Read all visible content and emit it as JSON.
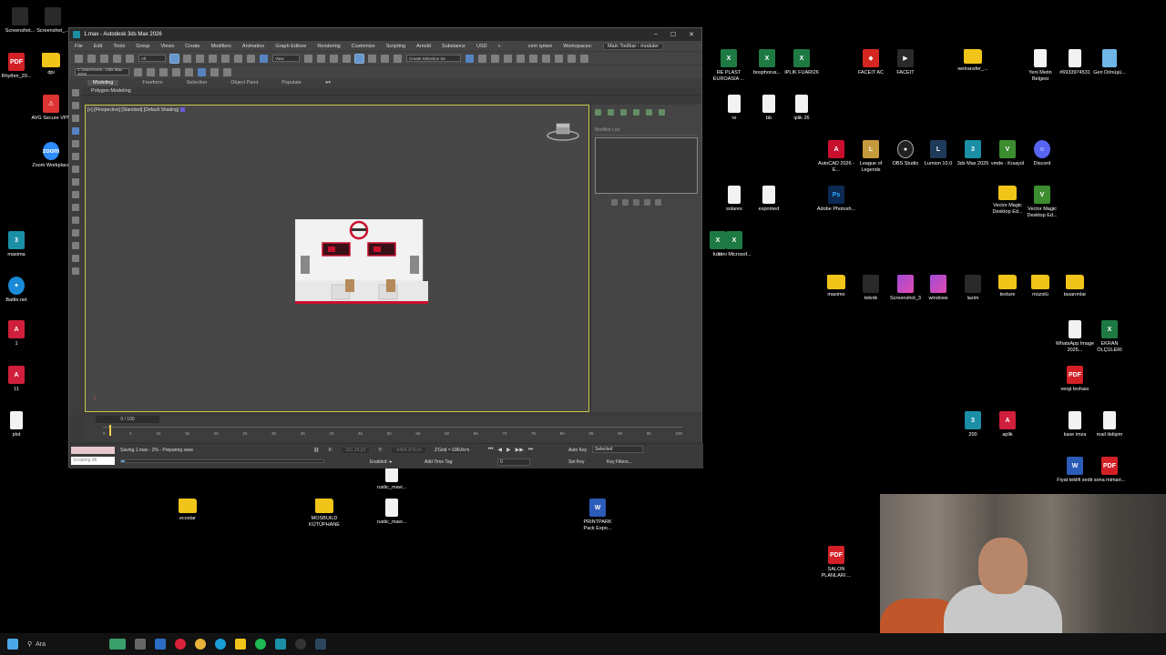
{
  "desktop": {
    "icons": [
      {
        "id": "screenshot1",
        "label": "Screenshot...",
        "type": "t-dark",
        "glyph": ""
      },
      {
        "id": "screenshot2",
        "label": "Screenshot_...",
        "type": "t-dark",
        "glyph": ""
      },
      {
        "id": "rhythm",
        "label": "Rhythm_20...",
        "type": "t-pdf",
        "glyph": "PDF"
      },
      {
        "id": "dpi",
        "label": "dpi",
        "type": "t-folder",
        "glyph": ""
      },
      {
        "id": "avg",
        "label": "AVG Secure VPN",
        "type": "t-avg",
        "glyph": "⚠"
      },
      {
        "id": "zoom",
        "label": "Zoom Workplace",
        "type": "t-zoom",
        "glyph": "zoom"
      },
      {
        "id": "maxima",
        "label": "maxima",
        "type": "t-max",
        "glyph": "3"
      },
      {
        "id": "battlenet",
        "label": "Battle.net",
        "type": "t-bnet",
        "glyph": "✦"
      },
      {
        "id": "fbx1",
        "label": "1",
        "type": "t-fbx",
        "glyph": "A"
      },
      {
        "id": "fbx11",
        "label": "11",
        "type": "t-fbx",
        "glyph": "A"
      },
      {
        "id": "plot",
        "label": "plot",
        "type": "t-file",
        "glyph": ""
      },
      {
        "id": "ecostar",
        "label": "ecostar",
        "type": "t-folder",
        "glyph": ""
      },
      {
        "id": "mosbuild",
        "label": "MOSBUILD KÜTÜPHANE",
        "type": "t-folder",
        "glyph": ""
      },
      {
        "id": "rustic2",
        "label": "rustic_mavi...",
        "type": "t-file",
        "glyph": ""
      },
      {
        "id": "rustic1",
        "label": "rustic_mavi...",
        "type": "t-file",
        "glyph": ""
      },
      {
        "id": "printpark",
        "label": "PRINTPARK Pack Expo...",
        "type": "t-doc",
        "glyph": "W"
      },
      {
        "id": "rexls",
        "label": "RE PLAST EUROASIA ...",
        "type": "t-xls",
        "glyph": "X"
      },
      {
        "id": "bosphorus",
        "label": "bosphorus...",
        "type": "t-xls",
        "glyph": "X"
      },
      {
        "id": "iplik",
        "label": "IPLIK FUARI26",
        "type": "t-xls",
        "glyph": "X"
      },
      {
        "id": "re",
        "label": "re",
        "type": "t-file",
        "glyph": ""
      },
      {
        "id": "bb",
        "label": "bb",
        "type": "t-file",
        "glyph": ""
      },
      {
        "id": "iplik26",
        "label": "iplik 26",
        "type": "t-file",
        "glyph": ""
      },
      {
        "id": "solarex",
        "label": "solarex",
        "type": "t-file",
        "glyph": ""
      },
      {
        "id": "expomed",
        "label": "expomed",
        "type": "t-file",
        "glyph": ""
      },
      {
        "id": "fuarx",
        "label": "fuari",
        "type": "t-xls",
        "glyph": "X"
      },
      {
        "id": "yeni",
        "label": "Yeni Microsof...",
        "type": "t-xls",
        "glyph": "X"
      },
      {
        "id": "faceitac",
        "label": "FACEIT AC",
        "type": "t-red",
        "glyph": "◆"
      },
      {
        "id": "faceit",
        "label": "FACEIT",
        "type": "t-dark",
        "glyph": "▶"
      },
      {
        "id": "wetransfer",
        "label": "wetransfer_...",
        "type": "t-folder",
        "glyph": ""
      },
      {
        "id": "yenimetin",
        "label": "Yeni Metin Belgesi",
        "type": "t-file",
        "glyph": ""
      },
      {
        "id": "num",
        "label": "#6933974531",
        "type": "t-file",
        "glyph": ""
      },
      {
        "id": "geri",
        "label": "Geri Dönüşü...",
        "type": "t-trash",
        "glyph": ""
      },
      {
        "id": "autocad",
        "label": "AutoCAD 2026 - E...",
        "type": "t-acad",
        "glyph": "A"
      },
      {
        "id": "lol",
        "label": "League of Legends",
        "type": "t-lol",
        "glyph": "L"
      },
      {
        "id": "obs",
        "label": "OBS Studio",
        "type": "t-obs",
        "glyph": "●"
      },
      {
        "id": "lumion",
        "label": "Lumion 10.0",
        "type": "t-lumion",
        "glyph": "L"
      },
      {
        "id": "max2026",
        "label": "3ds Max 2026",
        "type": "t-max",
        "glyph": "3"
      },
      {
        "id": "vmde",
        "label": "vmde - Kısayol",
        "type": "t-vm",
        "glyph": "V"
      },
      {
        "id": "discord",
        "label": "Discord",
        "type": "t-discord",
        "glyph": "☺"
      },
      {
        "id": "photoshop",
        "label": "Adobe Photosh...",
        "type": "t-ps",
        "glyph": "Ps"
      },
      {
        "id": "vm1",
        "label": "Vector Magic Desktop Ed...",
        "type": "t-folder",
        "glyph": ""
      },
      {
        "id": "vm2",
        "label": "Vector Magic Desktop Ed...",
        "type": "t-vm",
        "glyph": "V"
      },
      {
        "id": "maximo",
        "label": "maximo",
        "type": "t-folder",
        "glyph": ""
      },
      {
        "id": "teknik",
        "label": "teknik",
        "type": "t-dark",
        "glyph": ""
      },
      {
        "id": "ss3",
        "label": "Screenshot_3",
        "type": "t-img",
        "glyph": ""
      },
      {
        "id": "windows",
        "label": "windows",
        "type": "t-img",
        "glyph": ""
      },
      {
        "id": "lazim",
        "label": "lazim",
        "type": "t-dark",
        "glyph": ""
      },
      {
        "id": "texture",
        "label": "texture",
        "type": "t-folder",
        "glyph": ""
      },
      {
        "id": "muzstu",
        "label": "müzstü",
        "type": "t-folder",
        "glyph": ""
      },
      {
        "id": "tasarimlar",
        "label": "tasarımlar",
        "type": "t-folder",
        "glyph": ""
      },
      {
        "id": "whatsapp",
        "label": "WhatsApp Image 2025...",
        "type": "t-file",
        "glyph": ""
      },
      {
        "id": "ekran",
        "label": "EKRAN ÖLÇÜLERI",
        "type": "t-xls",
        "glyph": "X"
      },
      {
        "id": "vergi",
        "label": "vergi levhası",
        "type": "t-pdf",
        "glyph": "PDF"
      },
      {
        "id": "max200",
        "label": "200",
        "type": "t-max",
        "glyph": "3"
      },
      {
        "id": "aplik",
        "label": "aplik",
        "type": "t-fbx",
        "glyph": "A"
      },
      {
        "id": "kase",
        "label": "kase imza",
        "type": "t-file",
        "glyph": ""
      },
      {
        "id": "mail",
        "label": "mail iletişim",
        "type": "t-file",
        "glyph": ""
      },
      {
        "id": "fiyat",
        "label": "Fiyat teklifi sedir",
        "type": "t-doc",
        "glyph": "W"
      },
      {
        "id": "sona",
        "label": "sona mimari...",
        "type": "t-pdf",
        "glyph": "PDF"
      },
      {
        "id": "salon",
        "label": "SALON PLANLARI ...",
        "type": "t-pdf",
        "glyph": "PDF"
      }
    ]
  },
  "window": {
    "title": "1.max - Autodesk 3ds Max 2026",
    "controls": {
      "minimize": "–",
      "maximize": "☐",
      "close": "✕"
    },
    "menu": [
      "File",
      "Edit",
      "Tools",
      "Group",
      "Views",
      "Create",
      "Modifiers",
      "Animation",
      "Graph Editors",
      "Rendering",
      "Customize",
      "Scripting",
      "Arnold",
      "Substance",
      "USD"
    ],
    "menu_more": "»",
    "user": "cem işmen",
    "workspaces_label": "Workspaces:",
    "workspace_value": "Main Toolbar - moduler",
    "toolbar": {
      "filter_value": "All",
      "view_value": "View",
      "selection_set_placeholder": "Create Selection Se",
      "path_value": "C:\\Users\\cem...\\3ds Max 2026"
    },
    "ribbon_tabs": [
      "Modeling",
      "Freeform",
      "Selection",
      "Object Paint",
      "Populate"
    ],
    "ribbon_active": "Modeling",
    "ribbon_sub": "Polygon Modeling",
    "viewport": {
      "label": "[+] [Perspective] [Standard] [Default Shading]"
    },
    "command_panel": {
      "modifier_list": "Modifier List"
    },
    "timeline": {
      "frame_indicator": "0 / 100",
      "ticks": [
        "0",
        "5",
        "10",
        "15",
        "20",
        "25",
        "30",
        "35",
        "40",
        "45",
        "50",
        "55",
        "60",
        "65",
        "70",
        "75",
        "80",
        "85",
        "90",
        "95",
        "100"
      ]
    },
    "status": {
      "maxscript_placeholder": "Scripting Mi",
      "message": "Saving 1.max - 2% - Preparing save",
      "progress": 0.02,
      "x_label": "X:",
      "x_value": "181.28,92",
      "y_label": "Y:",
      "y_value": "-5464.476cm",
      "z_label": "Z:",
      "z_value": "0.0cm",
      "grid": "Grid = 100,0cm",
      "enabled": "Enabled:",
      "add_time_tag": "Add Time Tag",
      "auto_key": "Auto Key",
      "set_key": "Set Key",
      "selected": "Selected",
      "key_filters": "Key Filters...",
      "frame_value": "0"
    }
  },
  "taskbar": {
    "search_placeholder": "Ara"
  },
  "colors": {
    "accent": "#5b9bd5",
    "viewport_border": "#c8c84a"
  }
}
